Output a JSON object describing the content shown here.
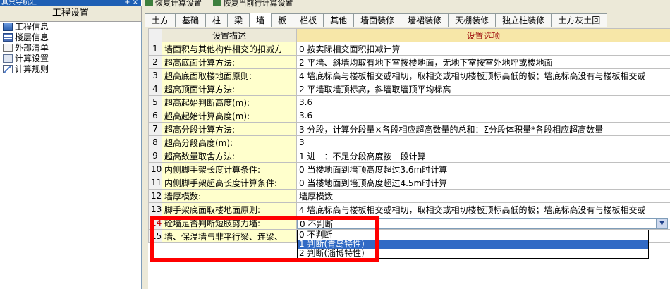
{
  "nav": {
    "title": "真只导航汇",
    "header": "工程设置",
    "items": [
      {
        "label": "工程信息",
        "icon": "info-icon"
      },
      {
        "label": "楼层信息",
        "icon": "floor-icon"
      },
      {
        "label": "外部清单",
        "icon": "list-icon"
      },
      {
        "label": "计算设置",
        "icon": "calc-icon"
      },
      {
        "label": "计算规则",
        "icon": "rule-icon"
      }
    ]
  },
  "toolbar": {
    "restore_calc": "恢复计算设置",
    "restore_row": "恢复当前行计算设置"
  },
  "tabs": [
    "土方",
    "基础",
    "柱",
    "梁",
    "墙",
    "板",
    "栏板",
    "其他",
    "墙面装修",
    "墙裙装修",
    "天棚装修",
    "独立柱装修",
    "土方灰土回"
  ],
  "active_tab": "墙",
  "grid": {
    "headers": {
      "desc": "设置描述",
      "option": "设置选项"
    },
    "rows": [
      {
        "n": "1",
        "desc": "墙面积与其他构件相交的扣减方",
        "val": "0 按实际相交面积扣减计算"
      },
      {
        "n": "2",
        "desc": "超高底面计算方法:",
        "val": "2 平墙、斜墙均取有地下室按楼地面，无地下室按室外地坪或楼地面"
      },
      {
        "n": "3",
        "desc": "超高底面取楼地面原则:",
        "val": "4 墙底标高与楼板相交或相切，取相交或相切楼板顶标高低的板；墙底标高没有与楼板相交或"
      },
      {
        "n": "4",
        "desc": "超高顶面计算方法:",
        "val": "2 平墙取墙顶标高，斜墙取墙顶平均标高"
      },
      {
        "n": "5",
        "desc": "超高起始判断高度(m):",
        "val": "3.6"
      },
      {
        "n": "6",
        "desc": "超高起始计算高度(m):",
        "val": "3.6"
      },
      {
        "n": "7",
        "desc": "超高分段计算方法:",
        "val": "3 分段，计算分段量×各段相应超高数量的总和：Σ分段体积量*各段相应超高数量"
      },
      {
        "n": "8",
        "desc": "超高分段高度(m):",
        "val": "3"
      },
      {
        "n": "9",
        "desc": "超高数量取舍方法:",
        "val": "1 进一：不足分段高度按一段计算"
      },
      {
        "n": "10",
        "desc": "内侧脚手架长度计算条件:",
        "val": "0 当楼地面到墙顶高度超过3.6m时计算"
      },
      {
        "n": "11",
        "desc": "内侧脚手架超高长度计算条件:",
        "val": "0 当楼地面到墙顶高度超过4.5m时计算"
      },
      {
        "n": "12",
        "desc": "墙厚模数:",
        "val": "墙厚模数"
      },
      {
        "n": "13",
        "desc": "脚手架底面取楼地面原则:",
        "val": "4 墙底标高与楼板相交或相切，取相交或相切楼板顶标高低的板；墙底标高没有与楼板相交或"
      },
      {
        "n": "14",
        "desc": "砼墙是否判断短肢剪力墙:",
        "val": ""
      },
      {
        "n": "15",
        "desc": "墙、保温墙与非平行梁、连梁、",
        "val": ""
      }
    ]
  },
  "combo": {
    "value": "0 不判断",
    "options": [
      "0 不判断",
      "1 判断(青岛特性)",
      "2 判断(淄博特性)"
    ],
    "highlighted": 1
  }
}
